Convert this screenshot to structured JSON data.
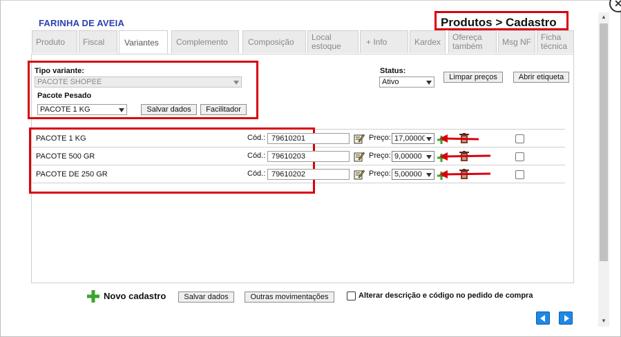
{
  "window": {
    "close_symbol": "✕"
  },
  "header": {
    "product_name": "FARINHA DE AVEIA",
    "breadcrumb": "Produtos > Cadastro"
  },
  "tabs": [
    {
      "line1": "Produto",
      "line2": ""
    },
    {
      "line1": "Fiscal",
      "line2": ""
    },
    {
      "line1": "Variantes",
      "line2": "",
      "active": true
    },
    {
      "line1": "Complemento",
      "line2": ""
    },
    {
      "line1": "Composição",
      "line2": ""
    },
    {
      "line1": "Local",
      "line2": "estoque"
    },
    {
      "line1": "+ Info",
      "line2": ""
    },
    {
      "line1": "Kardex",
      "line2": ""
    },
    {
      "line1": "Ofereça",
      "line2": "também"
    },
    {
      "line1": "Msg NF",
      "line2": ""
    },
    {
      "line1": "Ficha",
      "line2": "técnica"
    }
  ],
  "variant_form": {
    "tipo_label": "Tipo variante:",
    "tipo_value": "PACOTE SHOPEE",
    "pacote_label": "Pacote Pesado",
    "pacote_value": "PACOTE 1 KG",
    "save_label": "Salvar dados",
    "facilitador_label": "Facilitador"
  },
  "status": {
    "label": "Status:",
    "value": "Ativo"
  },
  "top_buttons": {
    "limpar_label": "Limpar preços",
    "etiqueta_label": "Abrir etiqueta"
  },
  "rows": [
    {
      "name": "PACOTE 1 KG",
      "cod_label": "Cód.:",
      "cod": "79610201",
      "preco_label": "Preço:",
      "preco": "17,00000"
    },
    {
      "name": "PACOTE 500 GR",
      "cod_label": "Cód.:",
      "cod": "79610203",
      "preco_label": "Preço:",
      "preco": "9,00000"
    },
    {
      "name": "PACOTE DE 250 GR",
      "cod_label": "Cód.:",
      "cod": "79610202",
      "preco_label": "Preço:",
      "preco": "5,00000"
    }
  ],
  "footer": {
    "novo_label": "Novo cadastro",
    "save_label": "Salvar dados",
    "outras_label": "Outras movimentações",
    "alterar_label": "Alterar descrição e código no pedido de compra"
  },
  "colors": {
    "accent_blue": "#2a3fb0",
    "annotation_red": "#d9000d",
    "nav_blue": "#1e88e5",
    "plus_green": "#3aa52b"
  }
}
